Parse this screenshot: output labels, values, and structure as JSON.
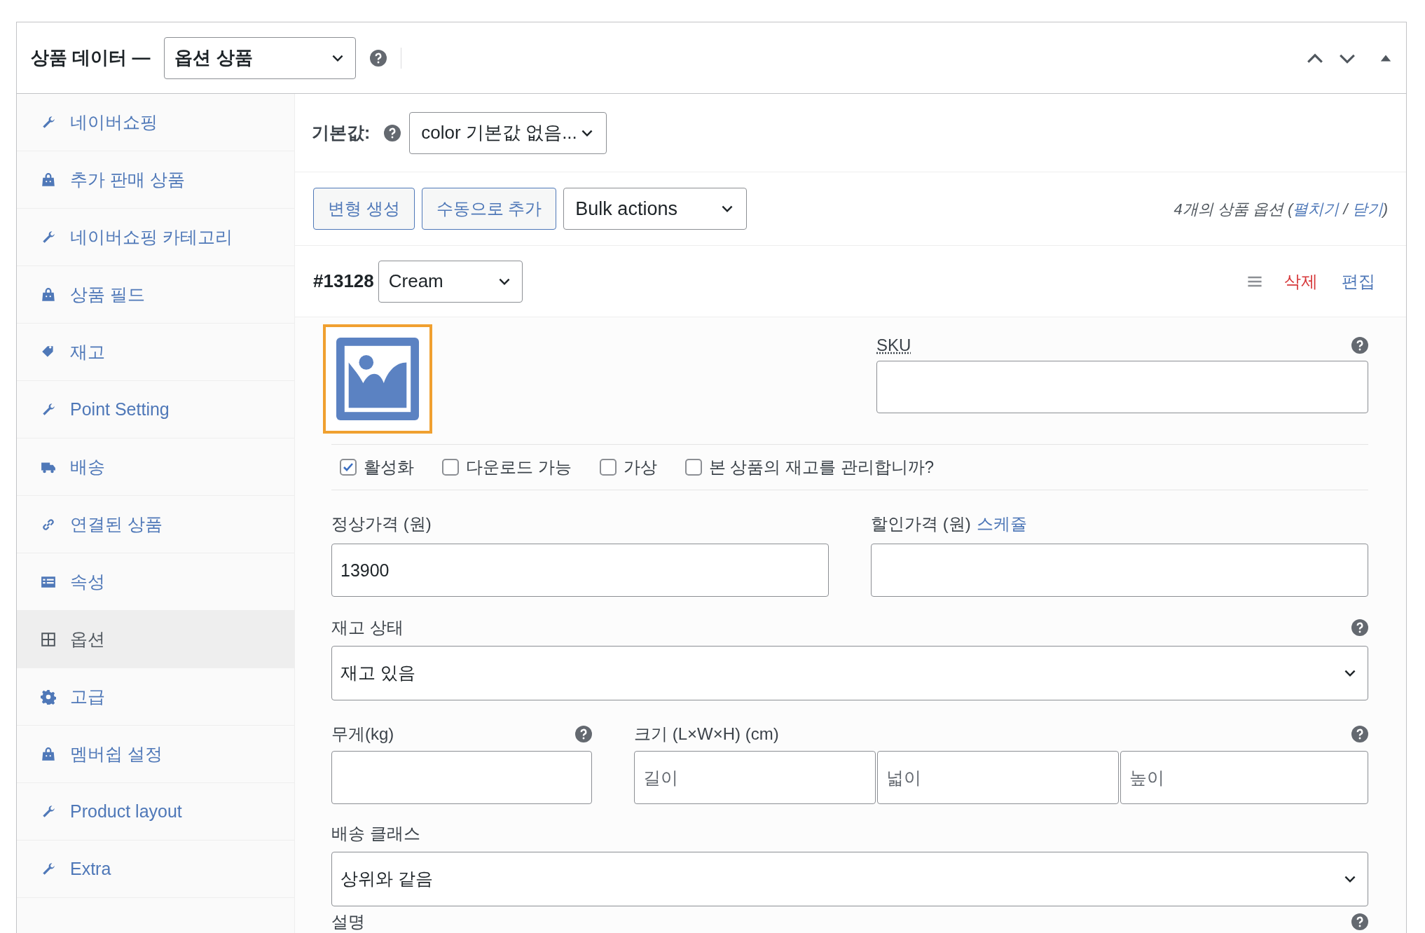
{
  "header": {
    "title": "상품 데이터 —",
    "product_type": "옵션 상품"
  },
  "sidebar": {
    "items": [
      {
        "label": "네이버쇼핑",
        "kind": "wrench",
        "selected": false
      },
      {
        "label": "추가 판매 상품",
        "kind": "bag",
        "selected": false
      },
      {
        "label": "네이버쇼핑 카테고리",
        "kind": "wrench",
        "selected": false
      },
      {
        "label": "상품 필드",
        "kind": "bag",
        "selected": false
      },
      {
        "label": "재고",
        "kind": "tag",
        "selected": false
      },
      {
        "label": "Point Setting",
        "kind": "wrench",
        "selected": false
      },
      {
        "label": "배송",
        "kind": "truck",
        "selected": false
      },
      {
        "label": "연결된 상품",
        "kind": "link",
        "selected": false
      },
      {
        "label": "속성",
        "kind": "card",
        "selected": false
      },
      {
        "label": "옵션",
        "kind": "grid",
        "selected": true
      },
      {
        "label": "고급",
        "kind": "gear",
        "selected": false
      },
      {
        "label": "멤버쉽 설정",
        "kind": "bag",
        "selected": false
      },
      {
        "label": "Product layout",
        "kind": "wrench",
        "selected": false
      },
      {
        "label": "Extra",
        "kind": "wrench",
        "selected": false
      }
    ]
  },
  "defaults": {
    "label": "기본값:",
    "value": "color 기본값 없음..."
  },
  "toolbar": {
    "buttons": [
      "변형 생성",
      "수동으로 추가"
    ],
    "bulk_select": "Bulk actions",
    "summary": {
      "prefix": "4개의 상품 옵션 (",
      "links": [
        "펼치기",
        "닫기"
      ],
      "separator": "/",
      "suffix": ")"
    }
  },
  "variation": {
    "id": "#13128",
    "attribute": "Cream",
    "delete": "삭제",
    "edit": "편집",
    "sku": {
      "label": "SKU"
    },
    "checkboxes": [
      {
        "label": "활성화",
        "checked": true
      },
      {
        "label": "다운로드 가능",
        "checked": false
      },
      {
        "label": "가상",
        "checked": false
      },
      {
        "label": "본 상품의 재고를 관리합니까?",
        "checked": false
      }
    ],
    "regular_price": {
      "label": "정상가격 (원)",
      "value": "13900"
    },
    "sale_price": {
      "label": "할인가격 (원)",
      "link": "스케쥴"
    },
    "stock_status": {
      "label": "재고 상태",
      "value": "재고 있음"
    },
    "weight": {
      "label": "무게(kg)"
    },
    "dimensions": {
      "label": "크기 (L×W×H) (cm)",
      "placeholders": [
        "길이",
        "넓이",
        "높이"
      ]
    },
    "shipping_class": {
      "label": "배송 클래스",
      "value": "상위와 같음"
    },
    "description": {
      "label": "설명"
    }
  }
}
